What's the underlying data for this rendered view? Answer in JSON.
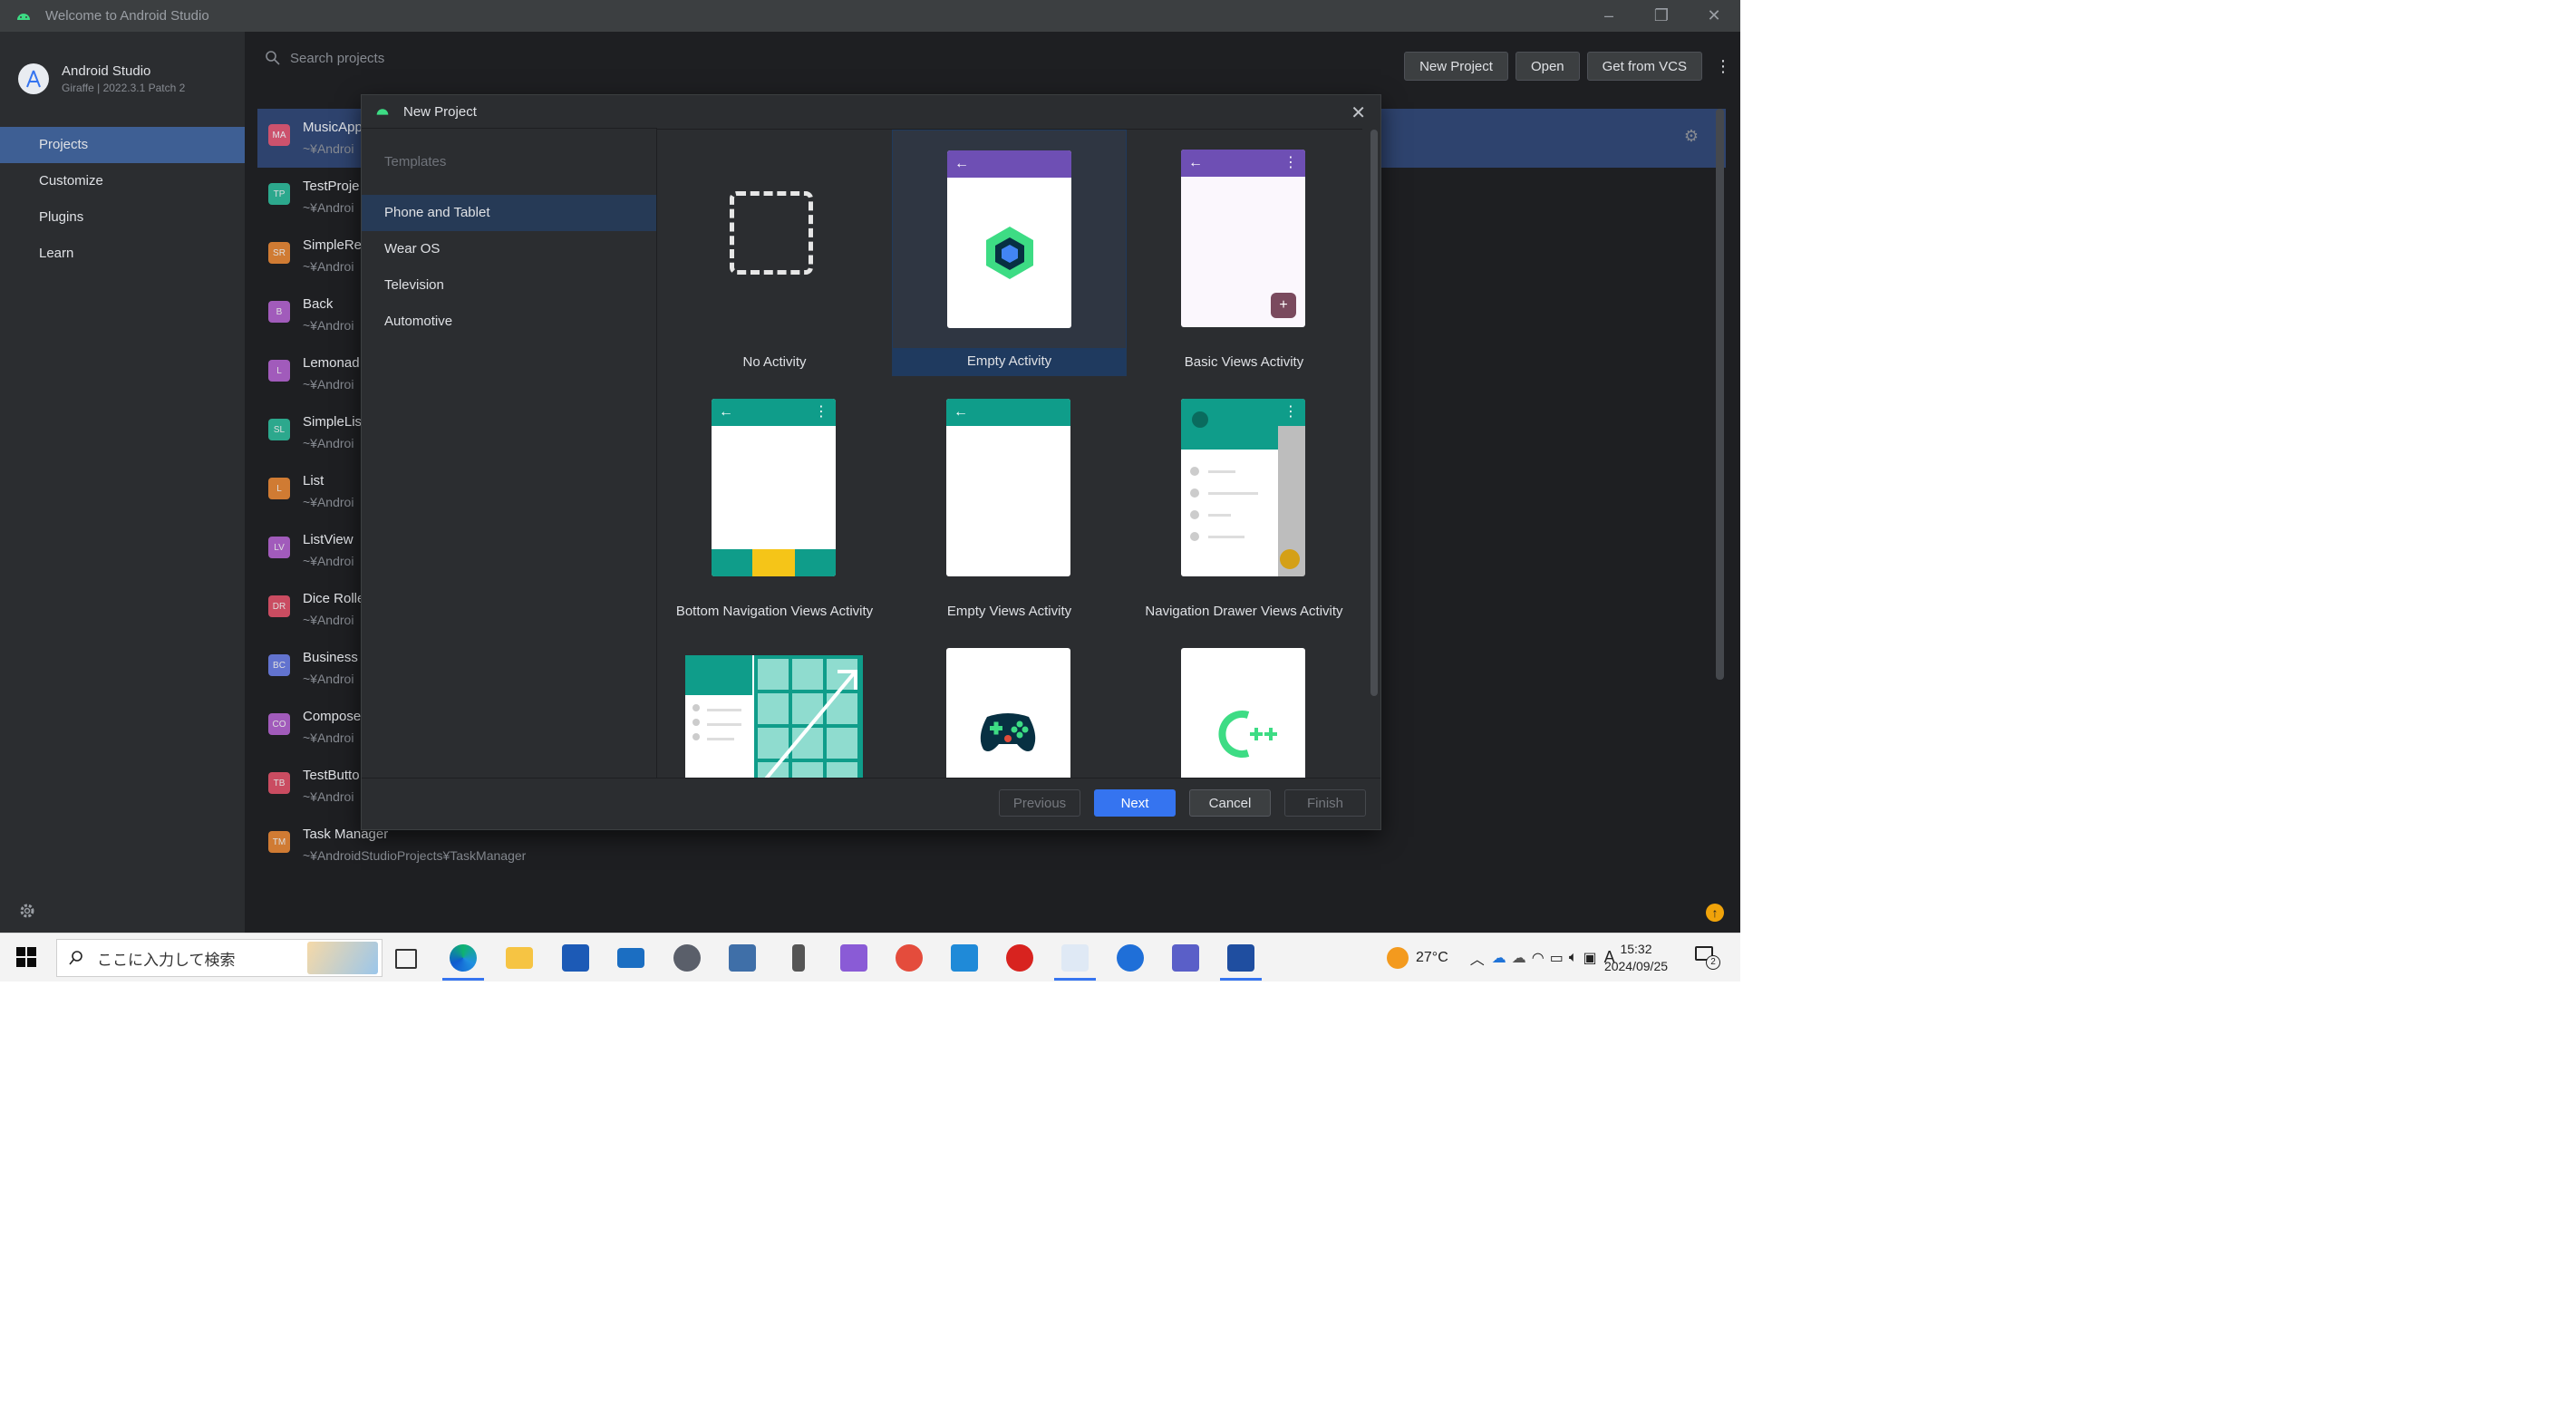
{
  "window": {
    "title": "Welcome to Android Studio",
    "controls": [
      "–",
      "❐",
      "✕"
    ]
  },
  "brand": {
    "name": "Android Studio",
    "version": "Giraffe | 2022.3.1 Patch 2"
  },
  "nav": {
    "items": [
      {
        "label": "Projects",
        "active": true
      },
      {
        "label": "Customize",
        "active": false
      },
      {
        "label": "Plugins",
        "active": false
      },
      {
        "label": "Learn",
        "active": false
      }
    ]
  },
  "search": {
    "placeholder": "Search projects"
  },
  "toolbar": {
    "new_project": "New Project",
    "open": "Open",
    "vcs": "Get from VCS"
  },
  "projects": [
    {
      "abbr": "MA",
      "name": "MusicApp",
      "path": "~¥Androi",
      "color": "#e8556d"
    },
    {
      "abbr": "TP",
      "name": "TestProje",
      "path": "~¥Androi",
      "color": "#2fc1a0"
    },
    {
      "abbr": "SR",
      "name": "SimpleRe",
      "path": "~¥Androi",
      "color": "#f08c36"
    },
    {
      "abbr": "B",
      "name": "Back",
      "path": "~¥Androi",
      "color": "#b966d6"
    },
    {
      "abbr": "L",
      "name": "Lemonad",
      "path": "~¥Androi",
      "color": "#b966d6"
    },
    {
      "abbr": "SL",
      "name": "SimpleLis",
      "path": "~¥Androi",
      "color": "#2fc1a0"
    },
    {
      "abbr": "L",
      "name": "List",
      "path": "~¥Androi",
      "color": "#f08c36"
    },
    {
      "abbr": "LV",
      "name": "ListView",
      "path": "~¥Androi",
      "color": "#b966d6"
    },
    {
      "abbr": "DR",
      "name": "Dice Rolle",
      "path": "~¥Androi",
      "color": "#e8556d"
    },
    {
      "abbr": "BC",
      "name": "Business C",
      "path": "~¥Androi",
      "color": "#6f82ee"
    },
    {
      "abbr": "CO",
      "name": "Compose",
      "path": "~¥Androi",
      "color": "#b966d6"
    },
    {
      "abbr": "TB",
      "name": "TestButto",
      "path": "~¥Androi",
      "color": "#e8556d"
    },
    {
      "abbr": "TM",
      "name": "Task Manager",
      "path": "~¥AndroidStudioProjects¥TaskManager",
      "color": "#f08c36"
    }
  ],
  "dialog": {
    "title": "New Project",
    "templates_header": "Templates",
    "categories": [
      {
        "label": "Phone and Tablet",
        "active": true
      },
      {
        "label": "Wear OS",
        "active": false
      },
      {
        "label": "Television",
        "active": false
      },
      {
        "label": "Automotive",
        "active": false
      }
    ],
    "templates": [
      {
        "label": "No Activity",
        "selected": false
      },
      {
        "label": "Empty Activity",
        "selected": true
      },
      {
        "label": "Basic Views Activity",
        "selected": false
      },
      {
        "label": "Bottom Navigation Views Activity",
        "selected": false
      },
      {
        "label": "Empty Views Activity",
        "selected": false
      },
      {
        "label": "Navigation Drawer Views Activity",
        "selected": false
      },
      {
        "label": "",
        "selected": false
      },
      {
        "label": "",
        "selected": false
      },
      {
        "label": "",
        "selected": false
      }
    ],
    "buttons": {
      "previous": "Previous",
      "next": "Next",
      "cancel": "Cancel",
      "finish": "Finish"
    }
  },
  "taskbar": {
    "search_placeholder": "ここに入力して検索",
    "weather": "27°C",
    "time": "15:32",
    "date": "2024/09/25",
    "ime": "A",
    "notifications": "2"
  },
  "colors": {
    "accent": "#3574f0",
    "selected_nav": "#3e5f94",
    "template_purple": "#6e4fb4",
    "template_teal": "#0f9d8a",
    "template_yellow": "#f5c518"
  }
}
